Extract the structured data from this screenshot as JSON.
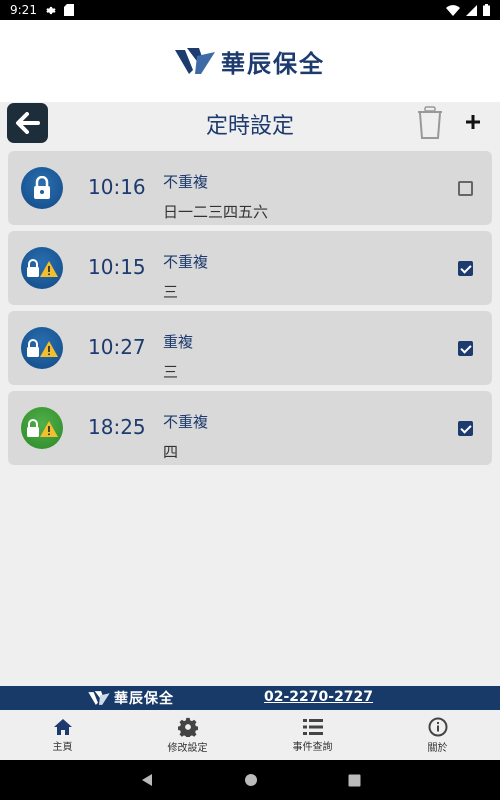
{
  "status_bar": {
    "time": "9:21"
  },
  "brand": {
    "name": "華辰保全"
  },
  "header": {
    "title": "定時設定"
  },
  "schedules": [
    {
      "time": "10:16",
      "repeat": "不重複",
      "days": "日一二三四五六",
      "icon": "lock-icon",
      "color": "#1d5fa0",
      "checked": false
    },
    {
      "time": "10:15",
      "repeat": "不重複",
      "days": "三",
      "icon": "lock-warning-icon",
      "color": "#1d5fa0",
      "checked": true
    },
    {
      "time": "10:27",
      "repeat": "重複",
      "days": "三",
      "icon": "lock-warning-icon",
      "color": "#1d5fa0",
      "checked": true
    },
    {
      "time": "18:25",
      "repeat": "不重複",
      "days": "四",
      "icon": "lock-warning-icon",
      "color": "#3a9a34",
      "checked": true
    }
  ],
  "footer": {
    "brand": "華辰保全",
    "phone": "02-2270-2727"
  },
  "tabs": [
    {
      "label": "主頁",
      "icon": "home-icon"
    },
    {
      "label": "修改設定",
      "icon": "gear-icon"
    },
    {
      "label": "事件查詢",
      "icon": "list-icon"
    },
    {
      "label": "關於",
      "icon": "info-icon"
    }
  ]
}
